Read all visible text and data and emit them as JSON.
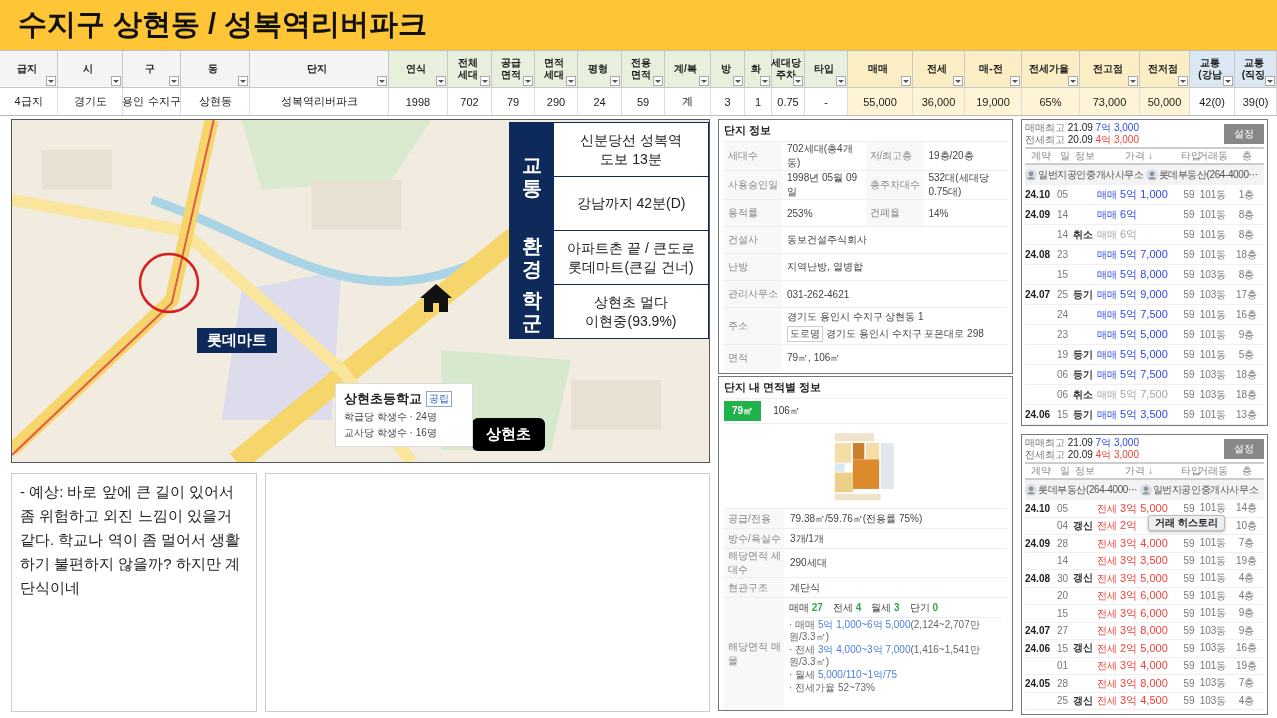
{
  "title": "수지구 상현동 / 성복역리버파크",
  "table": {
    "columns": [
      "급지",
      "시",
      "구",
      "동",
      "단지",
      "연식",
      "전체\n세대",
      "공급\n면적",
      "면적\n세대",
      "평형",
      "전용\n면적",
      "계/복",
      "방",
      "화",
      "세대당\n주차",
      "타입",
      "매매",
      "전세",
      "매-전",
      "전세가율",
      "전고점",
      "전저점",
      "교통\n(강남",
      "교통\n(직징"
    ],
    "row": [
      "4급지",
      "경기도",
      "용인 수지구",
      "상현동",
      "성복역리버파크",
      "1998",
      "702",
      "79",
      "290",
      "24",
      "59",
      "계",
      "3",
      "1",
      "0.75",
      "-",
      "55,000",
      "36,000",
      "19,000",
      "65%",
      "73,000",
      "50,000",
      "42(0)",
      "39(0)"
    ]
  },
  "map": {
    "kind": "picture",
    "summary": [
      {
        "heading": "교통",
        "cells": [
          "신분당선 성복역\n도보 13분",
          "강남까지 42분(D)"
        ]
      },
      {
        "heading": "환경",
        "cells": [
          "아파트촌 끝 / 큰도로\n롯데마트(큰길 건너)"
        ]
      },
      {
        "heading": "학군",
        "cells": [
          "상현초 멀다\n이현중(93.9%)"
        ]
      }
    ],
    "mart_label": "롯데마트",
    "school_label": "상현초",
    "school_card": {
      "name": "상현초등학교",
      "badge": "공립",
      "lines": [
        "학급당 학생수 · 24명",
        "교사당 학생수 · 16명"
      ]
    }
  },
  "memo": {
    "text": "- 예상: 바로 앞에 큰 길이 있어서 좀 위험하고 외진 느낌이 있을거 같다. 학교나 역이 좀 멀어서 생활하기 불편하지 않을까? 하지만 계단식이네"
  },
  "complex_info": {
    "title": "단지 정보",
    "rows": [
      {
        "label": "세대수",
        "value": "702세대(총4개동)",
        "label_2": "저/최고층",
        "value_2": "19층/20층"
      },
      {
        "label": "사용승인일",
        "value": "1998년 05월 09일",
        "label_2": "총주차대수",
        "value_2": "532대(세대당 0.75대)"
      },
      {
        "label": "용적률",
        "value": "253%",
        "label_2": "건폐율",
        "value_2": "14%"
      },
      {
        "label": "건설사",
        "value": "동보건설주식회사"
      },
      {
        "label": "난방",
        "value": "지역난방, 열병합"
      },
      {
        "label": "관리사무소",
        "value": "031-262-4621"
      },
      {
        "label": "주소",
        "value": "경기도 용인시 수지구 상현동 1",
        "road_tag": "도로명",
        "road_address": "경기도 용인시 수지구 포은대로 298"
      },
      {
        "label": "면적",
        "value": "79㎡, 106㎡"
      }
    ]
  },
  "area_info": {
    "title": "단지 내 면적별 정보",
    "tabs": [
      {
        "label": "79㎡",
        "selected": true
      },
      {
        "label": "106㎡",
        "selected": false
      }
    ],
    "rows": [
      {
        "label": "공급/전용",
        "value": "79.38㎡/59.76㎡(전용률 75%)"
      },
      {
        "label": "방수/욕실수",
        "value": "3개/1개"
      },
      {
        "label": "해당면적 세대수",
        "value": "290세대"
      },
      {
        "label": "현관구조",
        "value": "계단식"
      }
    ],
    "listings": {
      "label": "해당면적 매물",
      "counts": [
        {
          "label": "매매",
          "count": "27"
        },
        {
          "label": "전세",
          "count": "4"
        },
        {
          "label": "월세",
          "count": "3"
        },
        {
          "label": "단기",
          "count": "0"
        }
      ],
      "ranges": [
        {
          "label": "· 매매",
          "range": "5억 1,000~6억 5,000",
          "note": "(2,124~2,707만원/3.3㎡)"
        },
        {
          "label": "· 전세",
          "range": "3억 4,000~3억 7,000",
          "note": "(1,416~1,541만원/3.3㎡)"
        },
        {
          "label": "· 월세",
          "range": "5,000/110~1억/75"
        },
        {
          "label": "· 전세가율 52~73%"
        }
      ]
    }
  },
  "trade_panels": [
    {
      "kind": "sale",
      "highs": [
        {
          "label": "매매최고",
          "date": "21.09",
          "price": "7억 3,000",
          "kind": "sale"
        },
        {
          "label": "전세최고",
          "date": "20.09",
          "price": "4억 3,000",
          "kind": "jeonse"
        }
      ],
      "button": "설정",
      "columns": [
        "계약",
        "일",
        "정보",
        "가격 ↓",
        "타입",
        "거래동",
        "층"
      ],
      "agents": [
        "일번지공인중개사사무소",
        "롯데부동산(264-4000⋯"
      ],
      "rows": [
        {
          "month": "24.10",
          "day": "05",
          "type": "매매",
          "price": "5억 1,000",
          "size": "59",
          "dong": "101동",
          "floor": "1층",
          "cancelled": false
        },
        {
          "month": "24.09",
          "day": "14",
          "type": "매매",
          "price": "6억",
          "size": "59",
          "dong": "101동",
          "floor": "8층",
          "cancelled": false
        },
        {
          "day": "14",
          "info": "취소",
          "type": "매매",
          "price": "6억",
          "size": "59",
          "dong": "101동",
          "floor": "8층",
          "cancelled": true
        },
        {
          "month": "24.08",
          "day": "23",
          "type": "매매",
          "price": "5억 7,000",
          "size": "59",
          "dong": "101동",
          "floor": "18층",
          "cancelled": false
        },
        {
          "day": "15",
          "type": "매매",
          "price": "5억 8,000",
          "size": "59",
          "dong": "103동",
          "floor": "8층",
          "cancelled": false
        },
        {
          "month": "24.07",
          "day": "25",
          "info": "등기",
          "type": "매매",
          "price": "5억 9,000",
          "size": "59",
          "dong": "103동",
          "floor": "17층",
          "cancelled": false
        },
        {
          "day": "24",
          "type": "매매",
          "price": "5억 7,500",
          "size": "59",
          "dong": "101동",
          "floor": "16층",
          "cancelled": false
        },
        {
          "day": "23",
          "type": "매매",
          "price": "5억 5,000",
          "size": "59",
          "dong": "101동",
          "floor": "9층",
          "cancelled": false
        },
        {
          "day": "19",
          "info": "등기",
          "type": "매매",
          "price": "5억 5,000",
          "size": "59",
          "dong": "101동",
          "floor": "5층",
          "cancelled": false
        },
        {
          "day": "06",
          "info": "등기",
          "type": "매매",
          "price": "5억 7,500",
          "size": "59",
          "dong": "103동",
          "floor": "18층",
          "cancelled": false
        },
        {
          "day": "06",
          "info": "취소",
          "type": "매매",
          "price": "5억 7,500",
          "size": "59",
          "dong": "103동",
          "floor": "18층",
          "cancelled": true
        },
        {
          "month": "24.06",
          "day": "15",
          "info": "등기",
          "type": "매매",
          "price": "5억 3,500",
          "size": "59",
          "dong": "101동",
          "floor": "13층",
          "cancelled": false
        }
      ]
    },
    {
      "kind": "jeonse",
      "highs": [
        {
          "label": "매매최고",
          "date": "21.09",
          "price": "7억 3,000",
          "kind": "sale"
        },
        {
          "label": "전세최고",
          "date": "20.09",
          "price": "4억 3,000",
          "kind": "jeonse"
        }
      ],
      "button": "설정",
      "columns": [
        "계약",
        "일",
        "정보",
        "가격 ↓",
        "타입",
        "거래동",
        "층"
      ],
      "agents": [
        "롯데부동산(264-4000⋯",
        "일번지공인중개사사무소"
      ],
      "tooltip": "거래 히스토리",
      "rows": [
        {
          "month": "24.10",
          "day": "05",
          "type": "전세",
          "price": "3억 5,000",
          "size": "59",
          "dong": "101동",
          "floor": "14층",
          "cancelled": false
        },
        {
          "day": "04",
          "info": "갱신",
          "type": "전세",
          "price": "2억",
          "floor": "10층",
          "cancelled": false
        },
        {
          "month": "24.09",
          "day": "28",
          "type": "전세",
          "price": "3억 4,000",
          "size": "59",
          "dong": "101동",
          "floor": "7층",
          "cancelled": false
        },
        {
          "day": "14",
          "type": "전세",
          "price": "3억 3,500",
          "size": "59",
          "dong": "101동",
          "floor": "19층",
          "cancelled": false
        },
        {
          "month": "24.08",
          "day": "30",
          "info": "갱신",
          "type": "전세",
          "price": "3억 5,000",
          "size": "59",
          "dong": "101동",
          "floor": "4층",
          "cancelled": false
        },
        {
          "day": "20",
          "type": "전세",
          "price": "3억 6,000",
          "size": "59",
          "dong": "101동",
          "floor": "4층",
          "cancelled": false
        },
        {
          "day": "15",
          "type": "전세",
          "price": "3억 6,000",
          "size": "59",
          "dong": "101동",
          "floor": "9층",
          "cancelled": false
        },
        {
          "month": "24.07",
          "day": "27",
          "type": "전세",
          "price": "3억 8,000",
          "size": "59",
          "dong": "103동",
          "floor": "9층",
          "cancelled": false
        },
        {
          "month": "24.06",
          "day": "15",
          "info": "갱신",
          "type": "전세",
          "price": "2억 5,000",
          "size": "59",
          "dong": "103동",
          "floor": "16층",
          "cancelled": false
        },
        {
          "day": "01",
          "type": "전세",
          "price": "3억 4,000",
          "size": "59",
          "dong": "101동",
          "floor": "19층",
          "cancelled": false
        },
        {
          "month": "24.05",
          "day": "28",
          "type": "전세",
          "price": "3억 8,000",
          "size": "59",
          "dong": "103동",
          "floor": "7층",
          "cancelled": false
        },
        {
          "day": "25",
          "info": "갱신",
          "type": "전세",
          "price": "3억 4,500",
          "size": "59",
          "dong": "103동",
          "floor": "4층",
          "cancelled": false
        }
      ]
    }
  ]
}
